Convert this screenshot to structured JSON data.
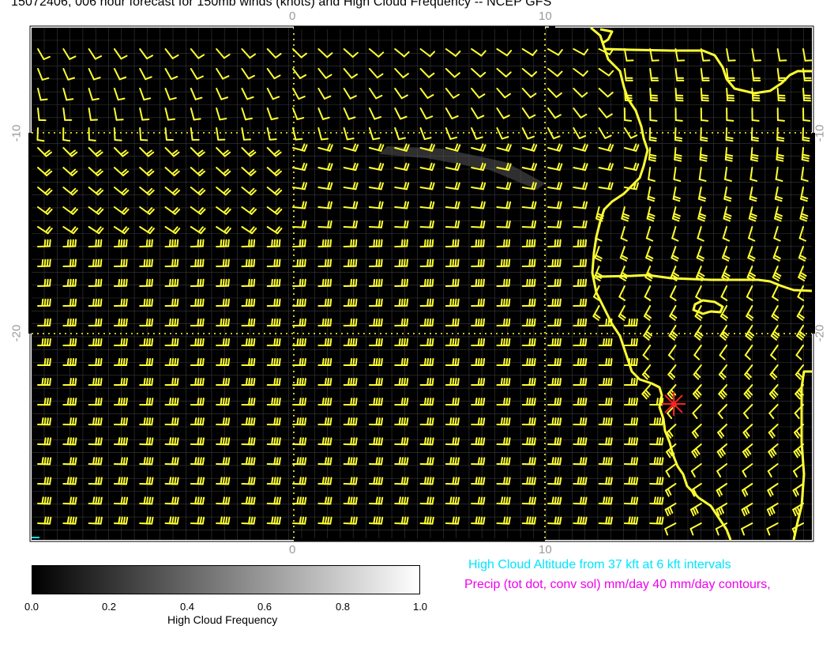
{
  "title": "15072406, 006 hour forecast for 150mb winds (knots) and High Cloud Frequency -- NCEP GFS",
  "map": {
    "background": "#000000",
    "barb_color": "#ffff33",
    "coast_color": "#ffff33",
    "marker_color": "#ff2020",
    "lon_labels": [
      "0",
      "10"
    ],
    "lat_labels": [
      "-10",
      "-20"
    ],
    "marker_icon": "asterisk-marker-icon"
  },
  "colorbar": {
    "ticks": [
      "0.0",
      "0.2",
      "0.4",
      "0.6",
      "0.8",
      "1.0"
    ],
    "label": "High Cloud Frequency",
    "color_min": "#000000",
    "color_max": "#ffffff"
  },
  "legend": {
    "high_cloud_altitude": "High Cloud Altitude from 37 kft at 6 kft intervals",
    "precip": "Precip (tot dot, conv sol) mm/day 40 mm/day contours,",
    "high_cloud_color": "#00e5ff",
    "precip_color": "#ee00ee"
  }
}
